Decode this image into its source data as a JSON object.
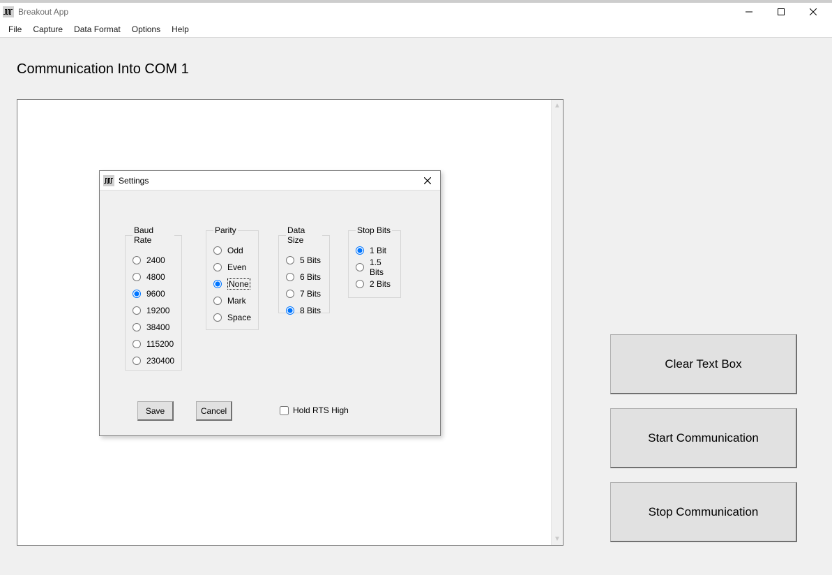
{
  "window": {
    "title": "Breakout App"
  },
  "menu": {
    "items": [
      "File",
      "Capture",
      "Data Format",
      "Options",
      "Help"
    ]
  },
  "main": {
    "title": "Communication Into COM 1",
    "buttons": {
      "clear": "Clear Text Box",
      "start": "Start Communication",
      "stop": "Stop Communication"
    }
  },
  "settings": {
    "title": "Settings",
    "groups": {
      "baud_rate": {
        "legend": "Baud Rate",
        "options": [
          "2400",
          "4800",
          "9600",
          "19200",
          "38400",
          "115200",
          "230400"
        ],
        "selected": "9600"
      },
      "parity": {
        "legend": "Parity",
        "options": [
          "Odd",
          "Even",
          "None",
          "Mark",
          "Space"
        ],
        "selected": "None"
      },
      "data_size": {
        "legend": "Data Size",
        "options": [
          "5 Bits",
          "6 Bits",
          "7 Bits",
          "8 Bits"
        ],
        "selected": "8 Bits"
      },
      "stop_bits": {
        "legend": "Stop Bits",
        "options": [
          "1 Bit",
          "1.5 Bits",
          "2 Bits"
        ],
        "selected": "1 Bit"
      }
    },
    "buttons": {
      "save": "Save",
      "cancel": "Cancel"
    },
    "hold_rts": {
      "label": "Hold RTS High",
      "checked": false
    }
  }
}
